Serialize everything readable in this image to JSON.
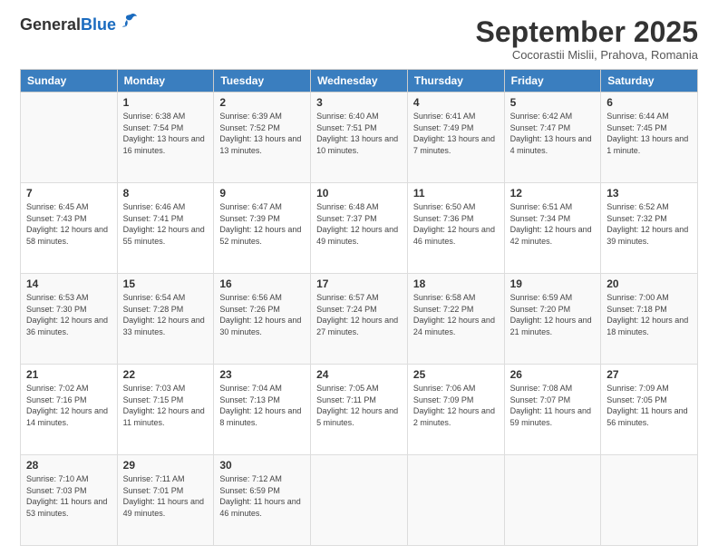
{
  "logo": {
    "line1": "General",
    "line2": "Blue"
  },
  "title": "September 2025",
  "location": "Cocorastii Mislii, Prahova, Romania",
  "days_of_week": [
    "Sunday",
    "Monday",
    "Tuesday",
    "Wednesday",
    "Thursday",
    "Friday",
    "Saturday"
  ],
  "weeks": [
    [
      {
        "day": "",
        "sunrise": "",
        "sunset": "",
        "daylight": ""
      },
      {
        "day": "1",
        "sunrise": "Sunrise: 6:38 AM",
        "sunset": "Sunset: 7:54 PM",
        "daylight": "Daylight: 13 hours and 16 minutes."
      },
      {
        "day": "2",
        "sunrise": "Sunrise: 6:39 AM",
        "sunset": "Sunset: 7:52 PM",
        "daylight": "Daylight: 13 hours and 13 minutes."
      },
      {
        "day": "3",
        "sunrise": "Sunrise: 6:40 AM",
        "sunset": "Sunset: 7:51 PM",
        "daylight": "Daylight: 13 hours and 10 minutes."
      },
      {
        "day": "4",
        "sunrise": "Sunrise: 6:41 AM",
        "sunset": "Sunset: 7:49 PM",
        "daylight": "Daylight: 13 hours and 7 minutes."
      },
      {
        "day": "5",
        "sunrise": "Sunrise: 6:42 AM",
        "sunset": "Sunset: 7:47 PM",
        "daylight": "Daylight: 13 hours and 4 minutes."
      },
      {
        "day": "6",
        "sunrise": "Sunrise: 6:44 AM",
        "sunset": "Sunset: 7:45 PM",
        "daylight": "Daylight: 13 hours and 1 minute."
      }
    ],
    [
      {
        "day": "7",
        "sunrise": "Sunrise: 6:45 AM",
        "sunset": "Sunset: 7:43 PM",
        "daylight": "Daylight: 12 hours and 58 minutes."
      },
      {
        "day": "8",
        "sunrise": "Sunrise: 6:46 AM",
        "sunset": "Sunset: 7:41 PM",
        "daylight": "Daylight: 12 hours and 55 minutes."
      },
      {
        "day": "9",
        "sunrise": "Sunrise: 6:47 AM",
        "sunset": "Sunset: 7:39 PM",
        "daylight": "Daylight: 12 hours and 52 minutes."
      },
      {
        "day": "10",
        "sunrise": "Sunrise: 6:48 AM",
        "sunset": "Sunset: 7:37 PM",
        "daylight": "Daylight: 12 hours and 49 minutes."
      },
      {
        "day": "11",
        "sunrise": "Sunrise: 6:50 AM",
        "sunset": "Sunset: 7:36 PM",
        "daylight": "Daylight: 12 hours and 46 minutes."
      },
      {
        "day": "12",
        "sunrise": "Sunrise: 6:51 AM",
        "sunset": "Sunset: 7:34 PM",
        "daylight": "Daylight: 12 hours and 42 minutes."
      },
      {
        "day": "13",
        "sunrise": "Sunrise: 6:52 AM",
        "sunset": "Sunset: 7:32 PM",
        "daylight": "Daylight: 12 hours and 39 minutes."
      }
    ],
    [
      {
        "day": "14",
        "sunrise": "Sunrise: 6:53 AM",
        "sunset": "Sunset: 7:30 PM",
        "daylight": "Daylight: 12 hours and 36 minutes."
      },
      {
        "day": "15",
        "sunrise": "Sunrise: 6:54 AM",
        "sunset": "Sunset: 7:28 PM",
        "daylight": "Daylight: 12 hours and 33 minutes."
      },
      {
        "day": "16",
        "sunrise": "Sunrise: 6:56 AM",
        "sunset": "Sunset: 7:26 PM",
        "daylight": "Daylight: 12 hours and 30 minutes."
      },
      {
        "day": "17",
        "sunrise": "Sunrise: 6:57 AM",
        "sunset": "Sunset: 7:24 PM",
        "daylight": "Daylight: 12 hours and 27 minutes."
      },
      {
        "day": "18",
        "sunrise": "Sunrise: 6:58 AM",
        "sunset": "Sunset: 7:22 PM",
        "daylight": "Daylight: 12 hours and 24 minutes."
      },
      {
        "day": "19",
        "sunrise": "Sunrise: 6:59 AM",
        "sunset": "Sunset: 7:20 PM",
        "daylight": "Daylight: 12 hours and 21 minutes."
      },
      {
        "day": "20",
        "sunrise": "Sunrise: 7:00 AM",
        "sunset": "Sunset: 7:18 PM",
        "daylight": "Daylight: 12 hours and 18 minutes."
      }
    ],
    [
      {
        "day": "21",
        "sunrise": "Sunrise: 7:02 AM",
        "sunset": "Sunset: 7:16 PM",
        "daylight": "Daylight: 12 hours and 14 minutes."
      },
      {
        "day": "22",
        "sunrise": "Sunrise: 7:03 AM",
        "sunset": "Sunset: 7:15 PM",
        "daylight": "Daylight: 12 hours and 11 minutes."
      },
      {
        "day": "23",
        "sunrise": "Sunrise: 7:04 AM",
        "sunset": "Sunset: 7:13 PM",
        "daylight": "Daylight: 12 hours and 8 minutes."
      },
      {
        "day": "24",
        "sunrise": "Sunrise: 7:05 AM",
        "sunset": "Sunset: 7:11 PM",
        "daylight": "Daylight: 12 hours and 5 minutes."
      },
      {
        "day": "25",
        "sunrise": "Sunrise: 7:06 AM",
        "sunset": "Sunset: 7:09 PM",
        "daylight": "Daylight: 12 hours and 2 minutes."
      },
      {
        "day": "26",
        "sunrise": "Sunrise: 7:08 AM",
        "sunset": "Sunset: 7:07 PM",
        "daylight": "Daylight: 11 hours and 59 minutes."
      },
      {
        "day": "27",
        "sunrise": "Sunrise: 7:09 AM",
        "sunset": "Sunset: 7:05 PM",
        "daylight": "Daylight: 11 hours and 56 minutes."
      }
    ],
    [
      {
        "day": "28",
        "sunrise": "Sunrise: 7:10 AM",
        "sunset": "Sunset: 7:03 PM",
        "daylight": "Daylight: 11 hours and 53 minutes."
      },
      {
        "day": "29",
        "sunrise": "Sunrise: 7:11 AM",
        "sunset": "Sunset: 7:01 PM",
        "daylight": "Daylight: 11 hours and 49 minutes."
      },
      {
        "day": "30",
        "sunrise": "Sunrise: 7:12 AM",
        "sunset": "Sunset: 6:59 PM",
        "daylight": "Daylight: 11 hours and 46 minutes."
      },
      {
        "day": "",
        "sunrise": "",
        "sunset": "",
        "daylight": ""
      },
      {
        "day": "",
        "sunrise": "",
        "sunset": "",
        "daylight": ""
      },
      {
        "day": "",
        "sunrise": "",
        "sunset": "",
        "daylight": ""
      },
      {
        "day": "",
        "sunrise": "",
        "sunset": "",
        "daylight": ""
      }
    ]
  ]
}
